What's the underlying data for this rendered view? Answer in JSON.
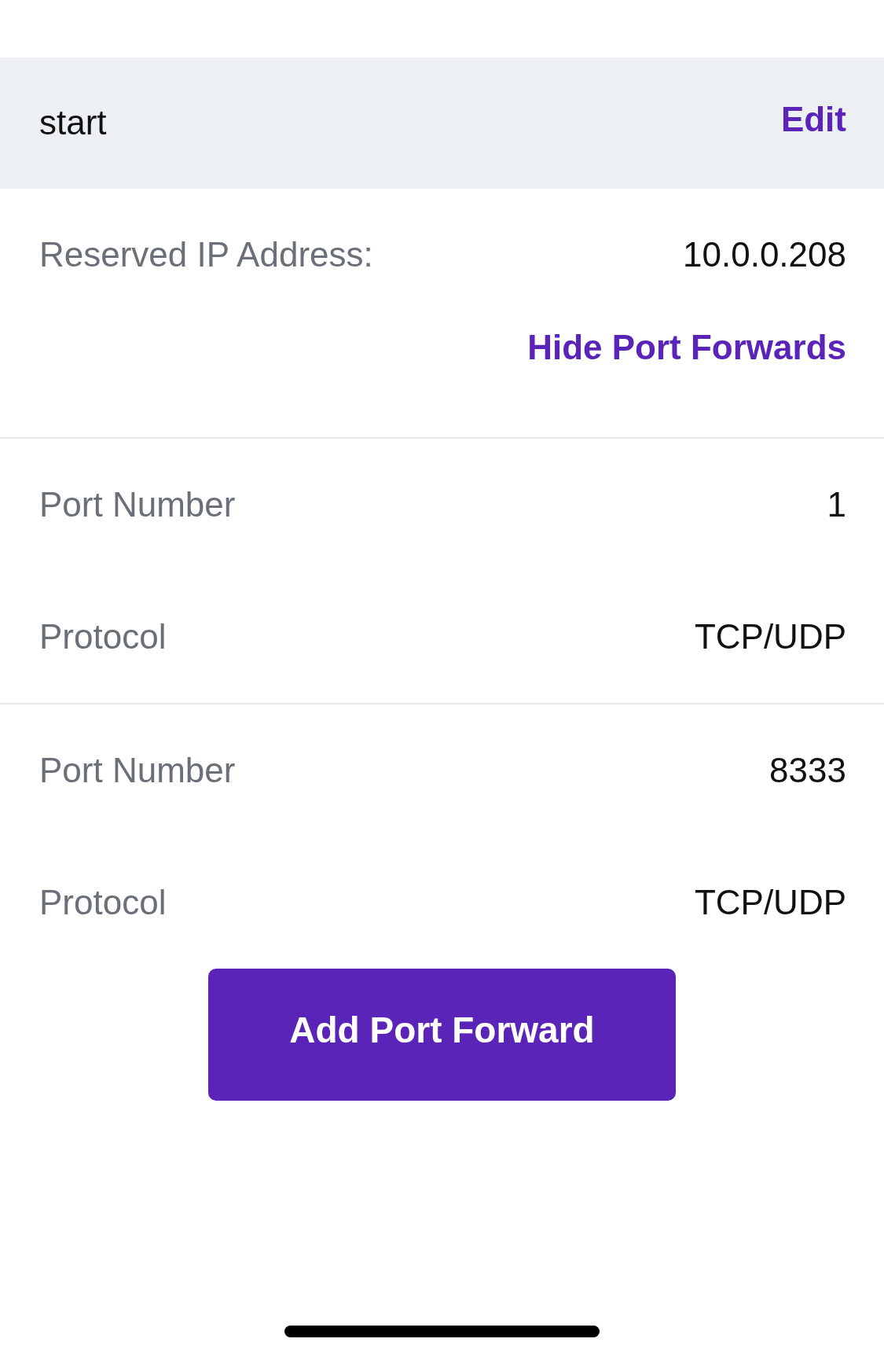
{
  "device": {
    "name": "start",
    "edit_link": "Edit"
  },
  "details": {
    "reserved_ip": {
      "label": "Reserved IP Address:",
      "value": "10.0.0.208"
    },
    "toggle_link": "Hide Port Forwards"
  },
  "port_forwards": [
    {
      "fields": [
        {
          "label": "Port Number",
          "value": "1"
        },
        {
          "label": "Protocol",
          "value": "TCP/UDP"
        }
      ]
    },
    {
      "fields": [
        {
          "label": "Port Number",
          "value": "8333"
        },
        {
          "label": "Protocol",
          "value": "TCP/UDP"
        }
      ]
    }
  ],
  "add_button": "Add Port Forward"
}
